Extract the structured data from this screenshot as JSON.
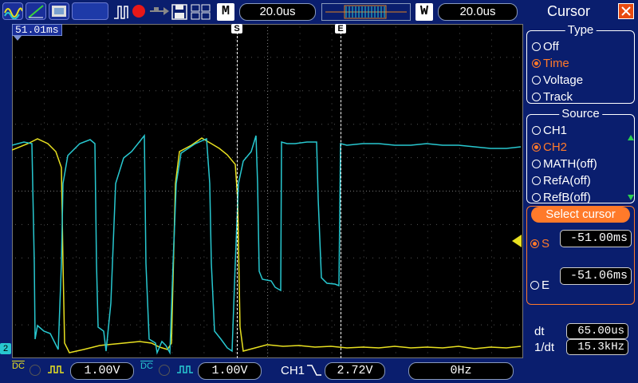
{
  "top_bar": {
    "mode_label": "M",
    "timebase": "20.0us",
    "window_label": "W",
    "window_timebase": "20.0us"
  },
  "screen": {
    "trigger_time_marker": "51.01ms",
    "cursor_s_label": "S",
    "cursor_e_label": "E",
    "trace_colors": {
      "ch1": "#e8e020",
      "ch2": "#28c8d0"
    }
  },
  "bottom_bar": {
    "ch1_coupling": "DC",
    "ch1_scale": "1.00V",
    "ch2_coupling": "DC",
    "ch2_scale": "1.00V",
    "trigger_source": "CH1",
    "trigger_level": "2.72V",
    "frequency": "0Hz"
  },
  "cursor_panel": {
    "title": "Cursor",
    "type": {
      "title": "Type",
      "options": [
        "Off",
        "Time",
        "Voltage",
        "Track"
      ],
      "selected": "Time"
    },
    "source": {
      "title": "Source",
      "options": [
        "CH1",
        "CH2",
        "MATH(off)",
        "RefA(off)",
        "RefB(off)"
      ],
      "selected": "CH2"
    },
    "select_cursor": {
      "title": "Select cursor",
      "s_label": "S",
      "s_value": "-51.00ms",
      "e_label": "E",
      "e_value": "-51.06ms"
    },
    "readout": {
      "dt_label": "dt",
      "dt_value": "65.00us",
      "inv_dt_label": "1/dt",
      "inv_dt_value": "15.3kHz"
    },
    "accent_color": "#ff7a2a"
  }
}
